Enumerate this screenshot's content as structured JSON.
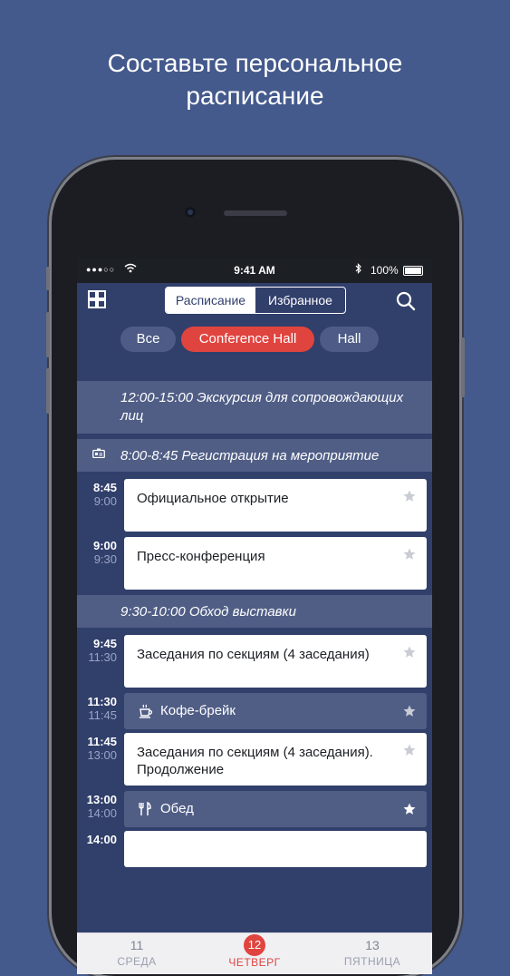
{
  "headline": {
    "line1": "Составьте персональное",
    "line2": "расписание"
  },
  "status_bar": {
    "time": "9:41 AM",
    "battery": "100%"
  },
  "nav": {
    "segments": [
      {
        "label": "Расписание",
        "active": true
      },
      {
        "label": "Избранное",
        "active": false
      }
    ]
  },
  "filters": [
    {
      "label": "Все",
      "active": false
    },
    {
      "label": "Conference Hall",
      "active": true
    },
    {
      "label": "Hall",
      "active": false
    }
  ],
  "schedule": {
    "header1": "12:00-15:00 Экскурсия для сопровождающих лиц",
    "header2": "8:00-8:45 Регистрация на мероприятие",
    "header3": "9:30-10:00 Обход выставки",
    "events": [
      {
        "start": "8:45",
        "end": "9:00",
        "title": "Официальное открытие"
      },
      {
        "start": "9:00",
        "end": "9:30",
        "title": "Пресс-конференция"
      },
      {
        "start": "9:45",
        "end": "11:30",
        "title": "Заседания по секциям (4 заседания)"
      },
      {
        "start": "11:30",
        "end": "11:45",
        "title": "Кофе-брейк"
      },
      {
        "start": "11:45",
        "end": "13:00",
        "title": "Заседания по секциям (4 заседания). Продолжение"
      },
      {
        "start": "13:00",
        "end": "14:00",
        "title": "Обед"
      },
      {
        "start": "14:00",
        "end": "",
        "title": ""
      }
    ]
  },
  "tabs": [
    {
      "day": "11",
      "weekday": "СРЕДА",
      "active": false
    },
    {
      "day": "12",
      "weekday": "ЧЕТВЕРГ",
      "active": true
    },
    {
      "day": "13",
      "weekday": "ПЯТНИЦА",
      "active": false
    }
  ],
  "colors": {
    "background": "#44598c",
    "screen": "#313f6b",
    "accent": "#e0443f",
    "card": "#ffffff",
    "section": "#505e86"
  }
}
